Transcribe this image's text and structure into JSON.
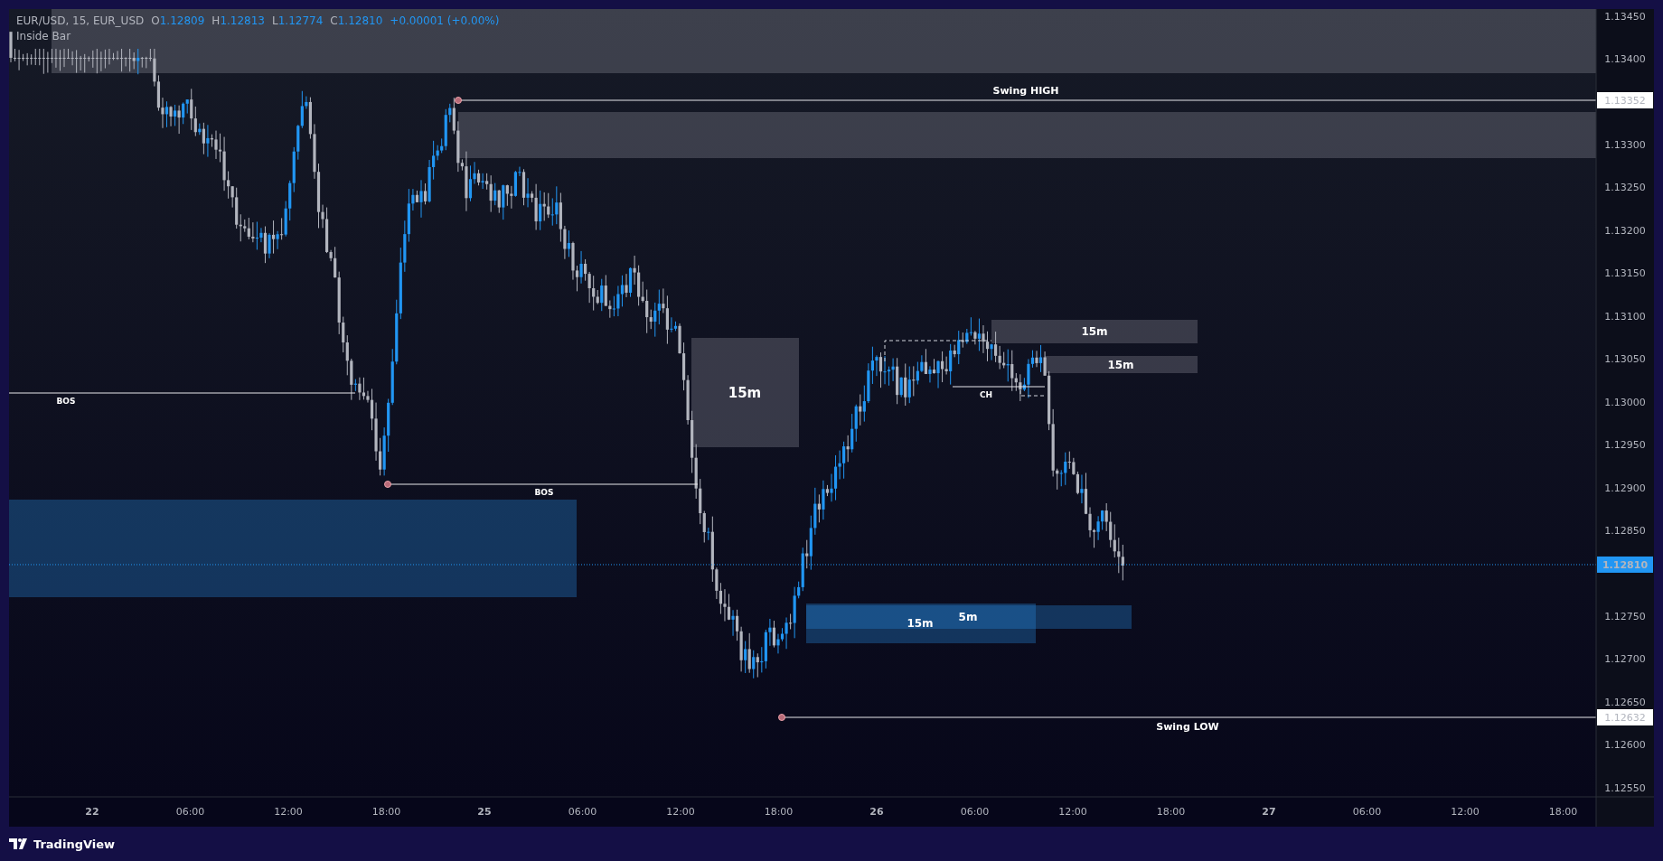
{
  "legend": {
    "symbol": "EUR/USD, 15, EUR_USD",
    "ohlc": [
      {
        "label": "O",
        "value": "1.12809"
      },
      {
        "label": "H",
        "value": "1.12813"
      },
      {
        "label": "L",
        "value": "1.12774"
      },
      {
        "label": "C",
        "value": "1.12810"
      }
    ],
    "change": "+0.00001 (+0.00%)",
    "indicator": "Inside Bar"
  },
  "zones": [
    {
      "kind": "supply"
    },
    {
      "kind": "supply"
    },
    {
      "kind": "supply",
      "label": "15m"
    },
    {
      "kind": "supply",
      "label": "15m"
    },
    {
      "kind": "supply",
      "label": "15m"
    },
    {
      "kind": "demand"
    },
    {
      "kind": "demand",
      "label": "15m"
    },
    {
      "kind": "demand",
      "label": "5m"
    }
  ],
  "levels": [
    {
      "kind": "swing",
      "label": "Swing HIGH",
      "price_tag": "1.13352"
    },
    {
      "kind": "swing",
      "label": "Swing LOW",
      "price_tag": "1.12632"
    },
    {
      "kind": "structure",
      "label": "BOS"
    },
    {
      "kind": "structure",
      "label": "BOS"
    },
    {
      "kind": "structure",
      "label": "CH"
    }
  ],
  "current_price": "1.12810",
  "price_axis": {
    "upper": [
      "1.13450",
      "1.13400",
      "1.13300",
      "1.13250",
      "1.13200",
      "1.13150",
      "1.13100",
      "1.13050",
      "1.13000",
      "1.12950",
      "1.12900",
      "1.12850"
    ],
    "lower": [
      "1.12750",
      "1.12700",
      "1.12650",
      "1.12600",
      "1.12550"
    ]
  },
  "time_axis": [
    {
      "text": "22",
      "kind": "day"
    },
    {
      "text": "06:00",
      "kind": "time"
    },
    {
      "text": "12:00",
      "kind": "time"
    },
    {
      "text": "18:00",
      "kind": "time"
    },
    {
      "text": "25",
      "kind": "day"
    },
    {
      "text": "06:00",
      "kind": "time"
    },
    {
      "text": "12:00",
      "kind": "time"
    },
    {
      "text": "18:00",
      "kind": "time"
    },
    {
      "text": "26",
      "kind": "day"
    },
    {
      "text": "06:00",
      "kind": "time"
    },
    {
      "text": "12:00",
      "kind": "time"
    },
    {
      "text": "18:00",
      "kind": "time"
    },
    {
      "text": "27",
      "kind": "day"
    },
    {
      "text": "06:00",
      "kind": "time"
    },
    {
      "text": "12:00",
      "kind": "time"
    },
    {
      "text": "18:00",
      "kind": "time"
    }
  ],
  "footer": {
    "brand": "TradingView"
  }
}
